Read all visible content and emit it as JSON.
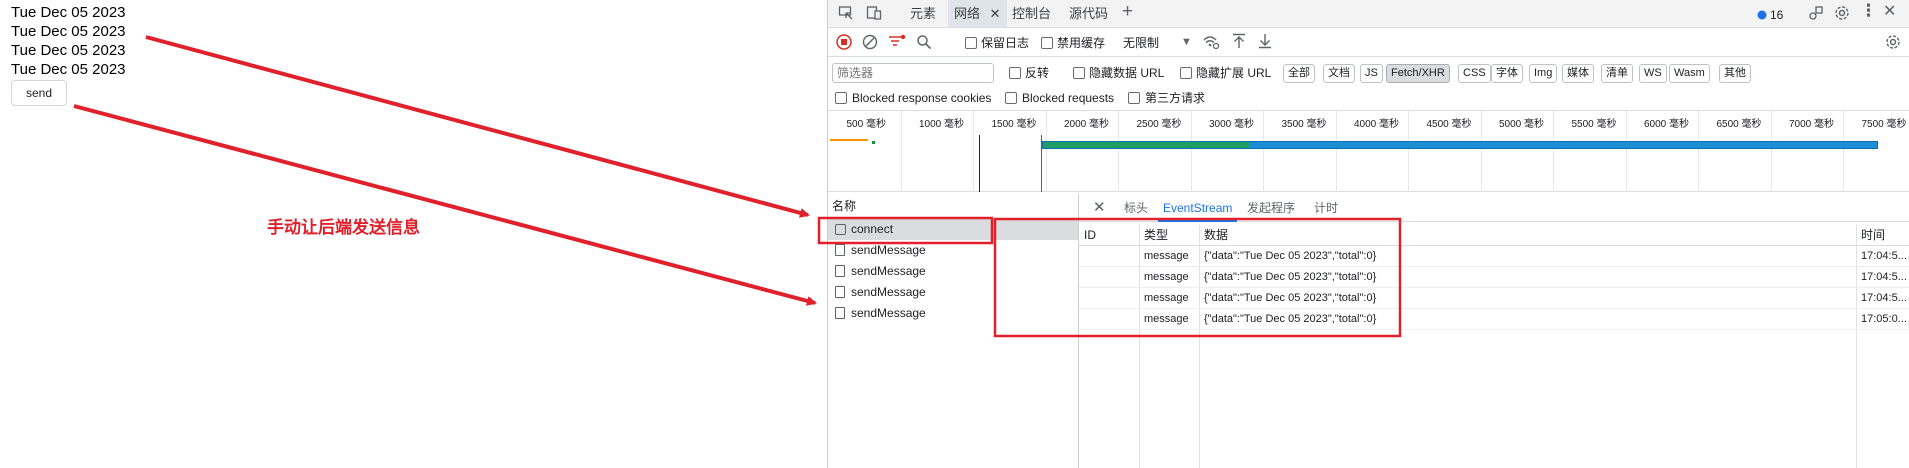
{
  "page": {
    "dates": [
      "Tue Dec 05 2023",
      "Tue Dec 05 2023",
      "Tue Dec 05 2023",
      "Tue Dec 05 2023"
    ],
    "send_label": "send"
  },
  "annotation": {
    "text": "手动让后端发送信息",
    "color": "#e0202b"
  },
  "devtools": {
    "tabs": [
      "元素",
      "网络",
      "控制台",
      "源代码"
    ],
    "active_tab": "网络",
    "issue_count": "16",
    "toolbar": {
      "preserve_log": "保留日志",
      "disable_cache": "禁用缓存",
      "throttle": "无限制"
    },
    "filter": {
      "placeholder": "筛选器",
      "invert": "反转",
      "hide_data_urls": "隐藏数据 URL",
      "hide_ext_urls": "隐藏扩展 URL",
      "types": [
        "全部",
        "文档",
        "JS",
        "Fetch/XHR",
        "CSS",
        "字体",
        "Img",
        "媒体",
        "清单",
        "WS",
        "Wasm",
        "其他"
      ],
      "selected_type": "Fetch/XHR",
      "blocked_cookies": "Blocked response cookies",
      "blocked_requests": "Blocked requests",
      "third_party": "第三方请求"
    },
    "timeline": {
      "ticks": [
        "500 毫秒",
        "1000 毫秒",
        "1500 毫秒",
        "2000 毫秒",
        "2500 毫秒",
        "3000 毫秒",
        "3500 毫秒",
        "4000 毫秒",
        "4500 毫秒",
        "5000 毫秒",
        "5500 毫秒",
        "6000 毫秒",
        "6500 毫秒",
        "7000 毫秒",
        "7500 毫秒"
      ]
    },
    "requests": {
      "header": "名称",
      "items": [
        {
          "name": "connect"
        },
        {
          "name": "sendMessage"
        },
        {
          "name": "sendMessage"
        },
        {
          "name": "sendMessage"
        },
        {
          "name": "sendMessage"
        }
      ]
    },
    "detail": {
      "tabs": [
        "标头",
        "EventStream",
        "发起程序",
        "计时"
      ],
      "active_tab": "EventStream",
      "columns": [
        "ID",
        "类型",
        "数据",
        "时间"
      ],
      "rows": [
        {
          "id": "",
          "type": "message",
          "data": "{\"data\":\"Tue Dec 05 2023\",\"total\":0}",
          "time": "17:04:5..."
        },
        {
          "id": "",
          "type": "message",
          "data": "{\"data\":\"Tue Dec 05 2023\",\"total\":0}",
          "time": "17:04:5..."
        },
        {
          "id": "",
          "type": "message",
          "data": "{\"data\":\"Tue Dec 05 2023\",\"total\":0}",
          "time": "17:04:5..."
        },
        {
          "id": "",
          "type": "message",
          "data": "{\"data\":\"Tue Dec 05 2023\",\"total\":0}",
          "time": "17:05:0..."
        }
      ]
    }
  }
}
